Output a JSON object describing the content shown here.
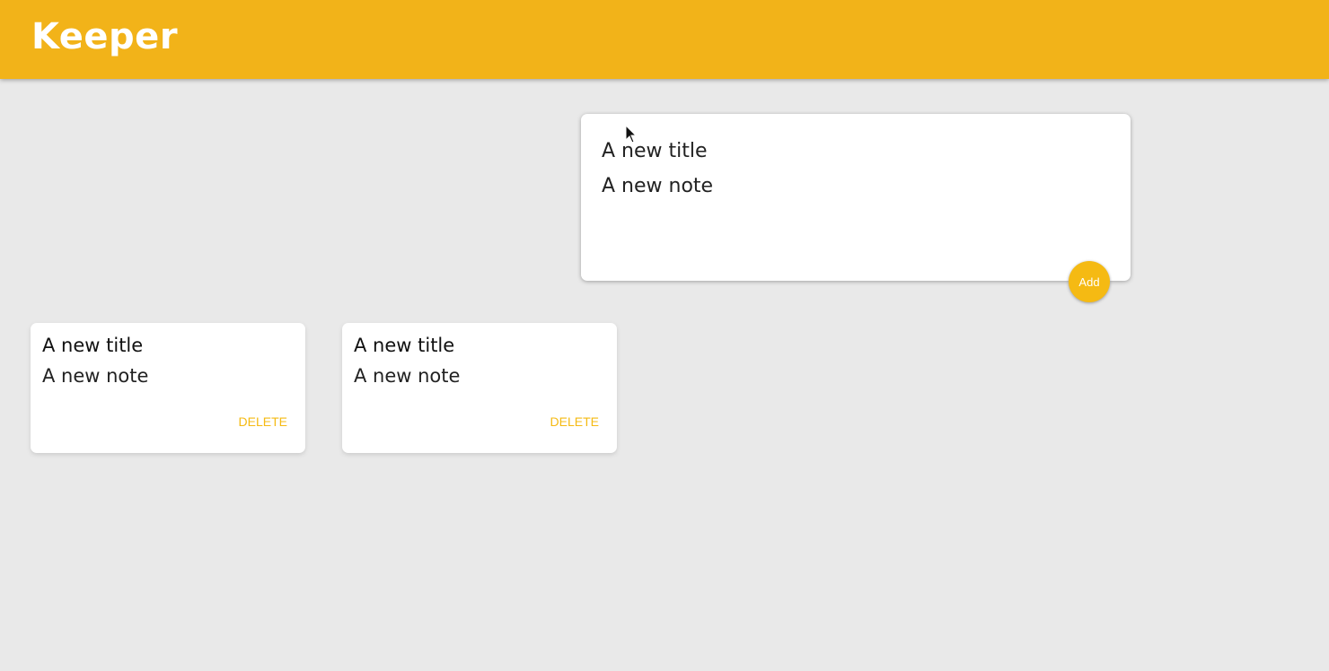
{
  "header": {
    "title": "Keeper"
  },
  "create_note": {
    "title_value": "A new title",
    "content_value": "A new note",
    "add_label": "Add"
  },
  "notes": [
    {
      "title": "A new title",
      "content": "A new note",
      "delete_label": "DELETE"
    },
    {
      "title": "A new title",
      "content": "A new note",
      "delete_label": "DELETE"
    }
  ],
  "colors": {
    "brand": "#f2b319",
    "accent": "#f5ba13",
    "background": "#e9e9e9"
  }
}
